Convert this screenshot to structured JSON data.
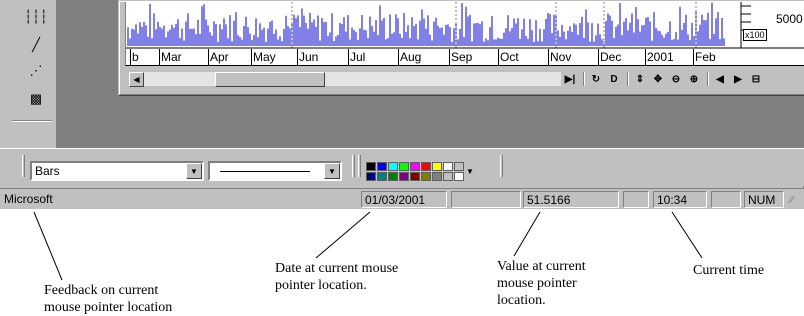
{
  "draw_tools": [
    {
      "name": "gridlines-tool-icon",
      "glyph": "┆┆┆"
    },
    {
      "name": "line-tool-icon",
      "glyph": "╱"
    },
    {
      "name": "fan-tool-icon",
      "glyph": "⋰"
    },
    {
      "name": "pattern-tool-icon",
      "glyph": "▩"
    }
  ],
  "chart": {
    "x_months": [
      "b",
      "Mar",
      "Apr",
      "May",
      "Jun",
      "Jul",
      "Aug",
      "Sep",
      "Oct",
      "Nov",
      "Dec",
      "2001",
      "Feb"
    ],
    "y_tick": "5000",
    "y_multiplier": "x100",
    "series_color": "#0000cc"
  },
  "nav_tools": [
    {
      "name": "scroll-end-icon",
      "glyph": "▶|"
    },
    {
      "name": "refresh-icon",
      "glyph": "↻"
    },
    {
      "name": "d-button-icon",
      "glyph": "D"
    },
    {
      "name": "vertical-scale-icon",
      "glyph": "⇕"
    },
    {
      "name": "crosshair-icon",
      "glyph": "✥"
    },
    {
      "name": "zoom-out-icon",
      "glyph": "⊖"
    },
    {
      "name": "zoom-in-icon",
      "glyph": "⊕"
    },
    {
      "name": "scroll-left-icon",
      "glyph": "◀"
    },
    {
      "name": "scroll-right-icon",
      "glyph": "▶"
    },
    {
      "name": "window-icon",
      "glyph": "⊟"
    }
  ],
  "format_toolbar": {
    "chart_type_value": "Bars",
    "line_style_value": "",
    "palette_colors": [
      "#000000",
      "#0000ff",
      "#00ffff",
      "#00ff00",
      "#ff00ff",
      "#ff0000",
      "#ffff00",
      "#ffffff",
      "#c0c0c0",
      "#000080",
      "#008080",
      "#008000",
      "#800080",
      "#800000",
      "#808000",
      "#808080",
      "#c0c0c0",
      "#ffffff"
    ]
  },
  "status_bar": {
    "message": "Microsoft",
    "date": "01/03/2001",
    "value": "51.5166",
    "time": "10:34",
    "num_lock": "NUM"
  },
  "annotations": {
    "feedback": [
      "Feedback on current",
      "mouse pointer location"
    ],
    "date": [
      "Date at current mouse",
      "pointer location."
    ],
    "value": [
      "Value at current",
      "mouse pointer",
      "location."
    ],
    "time": [
      "Current time"
    ]
  }
}
